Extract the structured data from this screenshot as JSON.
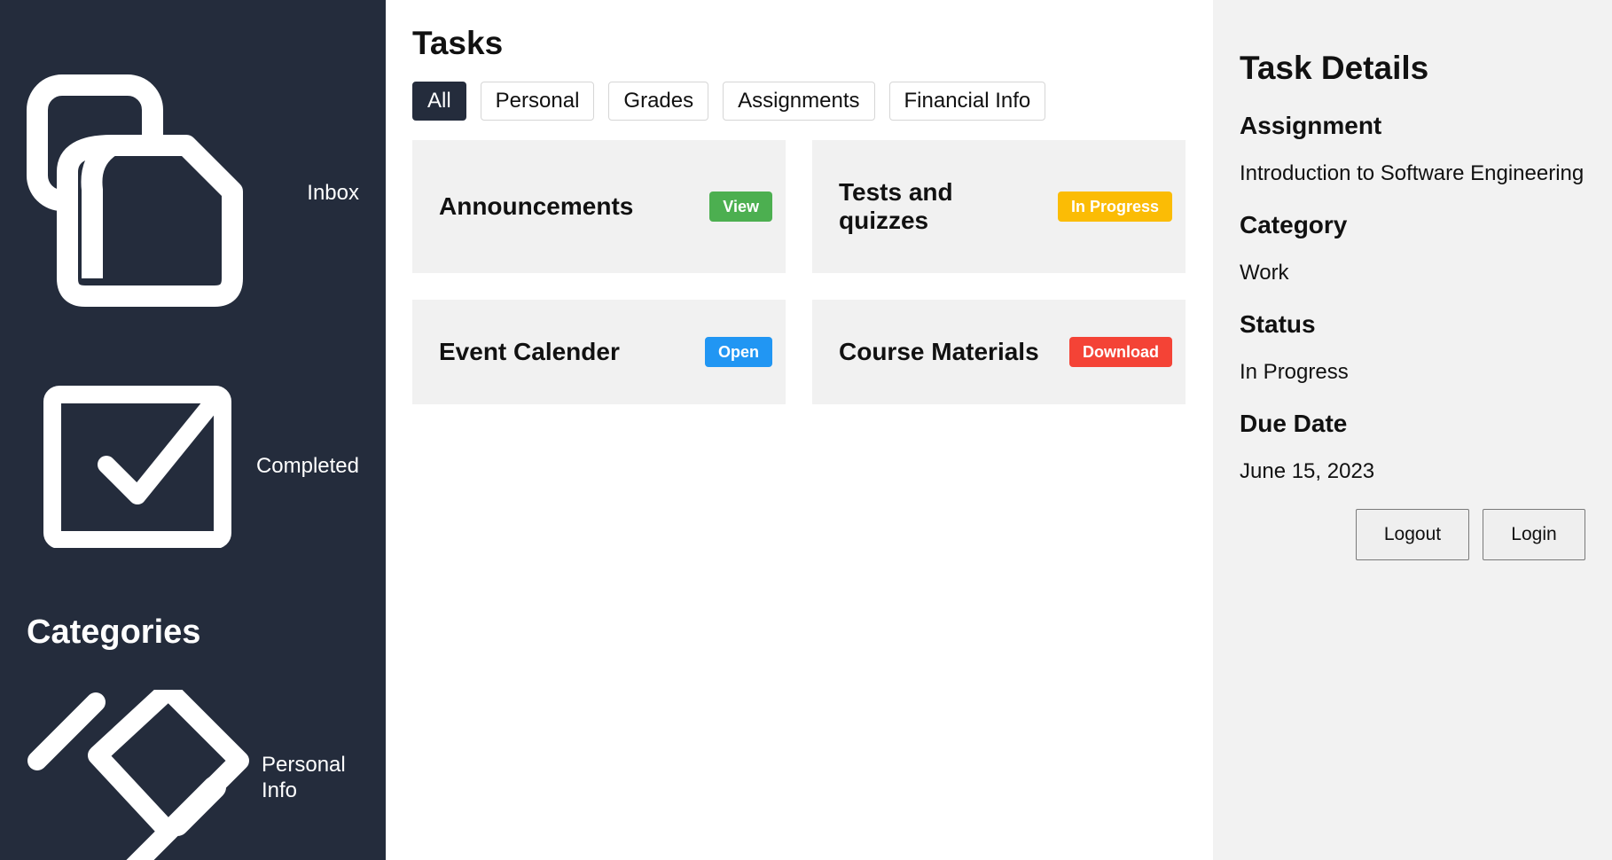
{
  "sidebar": {
    "items": [
      {
        "label": "Inbox",
        "icon": "inbox-icon"
      },
      {
        "label": "Completed",
        "icon": "checkbox-icon"
      },
      {
        "label": "Personal Info",
        "icon": "tag-icon"
      }
    ],
    "categories_heading": "Categories",
    "background": "#242c3c"
  },
  "main": {
    "title": "Tasks",
    "filters": [
      {
        "label": "All",
        "active": true
      },
      {
        "label": "Personal",
        "active": false
      },
      {
        "label": "Grades",
        "active": false
      },
      {
        "label": "Assignments",
        "active": false
      },
      {
        "label": "Financial Info",
        "active": false
      }
    ],
    "cards": [
      {
        "title": "Announcements",
        "action": "View",
        "color": "#4caf50"
      },
      {
        "title": "Tests and quizzes",
        "action": "In Progress",
        "color": "#fbbc05"
      },
      {
        "title": "Event Calender",
        "action": "Open",
        "color": "#2196f3"
      },
      {
        "title": "Course Materials",
        "action": "Download",
        "color": "#f44336"
      }
    ]
  },
  "details": {
    "title": "Task Details",
    "fields": [
      {
        "label": "Assignment",
        "value": "Introduction to Software Engineering"
      },
      {
        "label": "Category",
        "value": "Work"
      },
      {
        "label": "Status",
        "value": "In Progress"
      },
      {
        "label": "Due Date",
        "value": "June 15, 2023"
      }
    ],
    "logout_label": "Logout",
    "login_label": "Login"
  }
}
